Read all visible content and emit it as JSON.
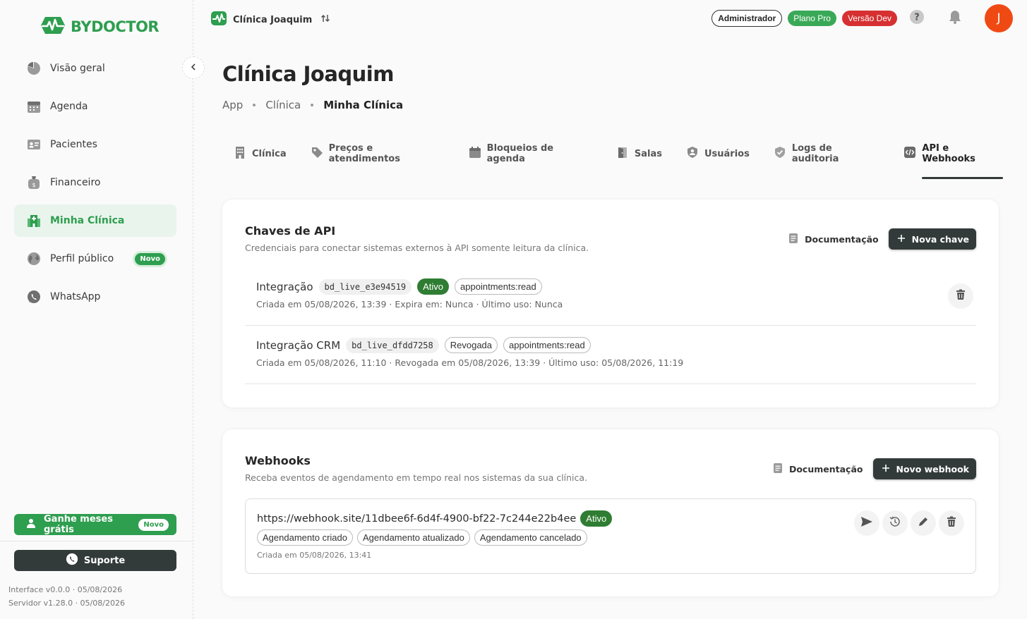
{
  "sidebar": {
    "logo": "BYDOCTOR",
    "items": [
      {
        "label": "Visão geral",
        "icon": "pie-chart-icon"
      },
      {
        "label": "Agenda",
        "icon": "calendar-icon"
      },
      {
        "label": "Pacientes",
        "icon": "id-card-icon"
      },
      {
        "label": "Financeiro",
        "icon": "money-bag-icon"
      },
      {
        "label": "Minha Clínica",
        "icon": "hospital-icon",
        "active": true
      },
      {
        "label": "Perfil público",
        "icon": "globe-icon",
        "badge": "Novo"
      },
      {
        "label": "WhatsApp",
        "icon": "whatsapp-icon"
      }
    ],
    "promo": {
      "label": "Ganhe meses grátis",
      "badge": "Novo"
    },
    "support": "Suporte",
    "interface_version": "Interface v0.0.0 · 05/08/2026",
    "server_version": "Servidor v1.28.0 · 05/08/2026"
  },
  "topbar": {
    "clinic": "Clínica Joaquim",
    "role": "Administrador",
    "plan": "Plano Pro",
    "env": "Versão Dev",
    "avatar_initial": "J"
  },
  "page": {
    "title": "Clínica Joaquim",
    "breadcrumb": [
      "App",
      "Clínica",
      "Minha Clínica"
    ]
  },
  "tabs": [
    {
      "label": "Clínica",
      "icon": "building-icon"
    },
    {
      "label": "Preços e atendimentos",
      "icon": "price-tag-icon"
    },
    {
      "label": "Bloqueios de agenda",
      "icon": "calendar-block-icon"
    },
    {
      "label": "Salas",
      "icon": "door-icon"
    },
    {
      "label": "Usuários",
      "icon": "user-shield-icon"
    },
    {
      "label": "Logs de auditoria",
      "icon": "shield-check-icon"
    },
    {
      "label": "API e Webhooks",
      "icon": "code-icon",
      "active": true
    }
  ],
  "api_keys": {
    "title": "Chaves de API",
    "subtitle": "Credenciais para conectar sistemas externos à API somente leitura da clínica.",
    "doc_label": "Documentação",
    "new_label": "Nova chave",
    "keys": [
      {
        "name": "Integração",
        "key": "bd_live_e3e94519",
        "status": "Ativo",
        "scope": "appointments:read",
        "meta": "Criada em 05/08/2026, 13:39 · Expira em: Nunca · Último uso: Nunca"
      },
      {
        "name": "Integração CRM",
        "key": "bd_live_dfdd7258",
        "status": "Revogada",
        "scope": "appointments:read",
        "meta": "Criada em 05/08/2026, 11:10 · Revogada em 05/08/2026, 13:39 · Último uso: 05/08/2026, 11:19"
      }
    ]
  },
  "webhooks": {
    "title": "Webhooks",
    "subtitle": "Receba eventos de agendamento em tempo real nos sistemas da sua clínica.",
    "doc_label": "Documentação",
    "new_label": "Novo webhook",
    "items": [
      {
        "url": "https://webhook.site/11dbee6f-6d4f-4900-bf22-7c244e22b4ee",
        "status": "Ativo",
        "events": [
          "Agendamento criado",
          "Agendamento atualizado",
          "Agendamento cancelado"
        ],
        "meta": "Criada em 05/08/2026, 13:41"
      }
    ]
  },
  "colors": {
    "brand_green": "#2e9e4f",
    "dark_button": "#333b3a",
    "status_active": "#2f7d32",
    "env_red": "#d63031",
    "avatar": "#f04a14"
  }
}
